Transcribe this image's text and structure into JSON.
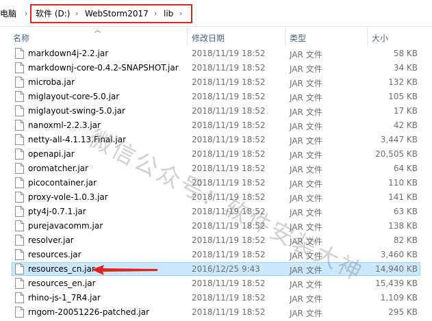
{
  "breadcrumb": {
    "items": [
      "电脑",
      "软件 (D:)",
      "WebStorm2017",
      "lib"
    ]
  },
  "columns": {
    "name": "名称",
    "modified": "修改日期",
    "type": "类型",
    "size": "大小"
  },
  "files": [
    {
      "name": "markdown4j-2.2.jar",
      "date": "2018/11/19 18:52",
      "type": "JAR 文件",
      "size": "58 KB"
    },
    {
      "name": "markdownj-core-0.4.2-SNAPSHOT.jar",
      "date": "2018/11/19 18:52",
      "type": "JAR 文件",
      "size": "34 KB"
    },
    {
      "name": "microba.jar",
      "date": "2018/11/19 18:52",
      "type": "JAR 文件",
      "size": "132 KB"
    },
    {
      "name": "miglayout-core-5.0.jar",
      "date": "2018/11/19 18:52",
      "type": "JAR 文件",
      "size": "105 KB"
    },
    {
      "name": "miglayout-swing-5.0.jar",
      "date": "2018/11/19 18:52",
      "type": "JAR 文件",
      "size": "17 KB"
    },
    {
      "name": "nanoxml-2.2.3.jar",
      "date": "2018/11/19 18:52",
      "type": "JAR 文件",
      "size": "42 KB"
    },
    {
      "name": "netty-all-4.1.13.Final.jar",
      "date": "2018/11/19 18:52",
      "type": "JAR 文件",
      "size": "3,447 KB"
    },
    {
      "name": "openapi.jar",
      "date": "2018/11/19 18:52",
      "type": "JAR 文件",
      "size": "20,505 KB"
    },
    {
      "name": "oromatcher.jar",
      "date": "2018/11/19 18:52",
      "type": "JAR 文件",
      "size": "64 KB"
    },
    {
      "name": "picocontainer.jar",
      "date": "2018/11/19 18:52",
      "type": "JAR 文件",
      "size": "110 KB"
    },
    {
      "name": "proxy-vole-1.0.3.jar",
      "date": "2018/11/19 18:52",
      "type": "JAR 文件",
      "size": "141 KB"
    },
    {
      "name": "pty4j-0.7.1.jar",
      "date": "2018/11/19 18:52",
      "type": "JAR 文件",
      "size": "63 KB"
    },
    {
      "name": "purejavacomm.jar",
      "date": "2018/11/19 18:52",
      "type": "JAR 文件",
      "size": "138 KB"
    },
    {
      "name": "resolver.jar",
      "date": "2018/11/19 18:52",
      "type": "JAR 文件",
      "size": "82 KB"
    },
    {
      "name": "resources.jar",
      "date": "2018/11/19 18:52",
      "type": "JAR 文件",
      "size": "3,460 KB"
    },
    {
      "name": "resources_cn.jar",
      "date": "2016/12/25 9:43",
      "type": "JAR 文件",
      "size": "14,940 KB"
    },
    {
      "name": "resources_en.jar",
      "date": "2018/11/19 18:52",
      "type": "JAR 文件",
      "size": "15,439 KB"
    },
    {
      "name": "rhino-js-1_7R4.jar",
      "date": "2018/11/19 18:52",
      "type": "JAR 文件",
      "size": "1,109 KB"
    },
    {
      "name": "rngom-20051226-patched.jar",
      "date": "2018/11/19 18:52",
      "type": "JAR 文件",
      "size": "295 KB"
    }
  ],
  "selected_file": "resources_cn.jar",
  "watermark": "微信公众号：软件安装大神",
  "colors": {
    "highlight_border": "#e0241b",
    "arrow": "#e0241b",
    "selection_bg": "#cce8ff",
    "header_text": "#4c607a"
  }
}
